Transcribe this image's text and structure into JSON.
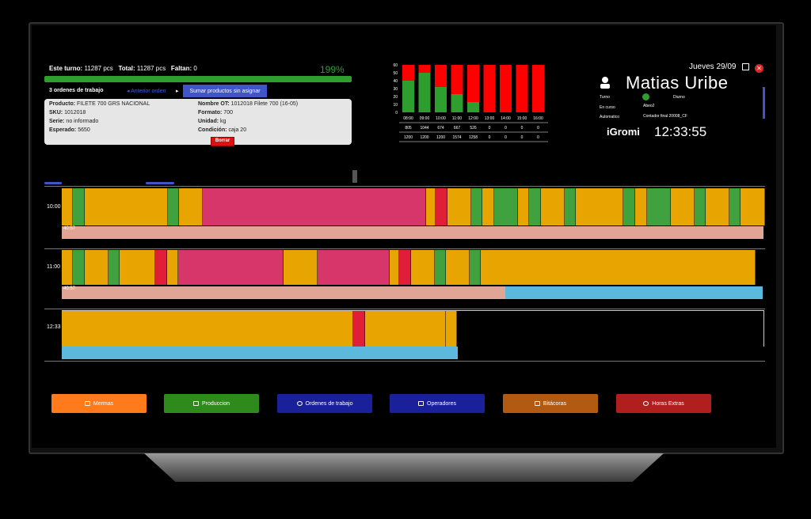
{
  "header": {
    "turno_label": "Este turno:",
    "turno_value": "11287 pcs",
    "total_label": "Total:",
    "total_value": "11287 pcs",
    "faltan_label": "Faltan:",
    "faltan_value": "0",
    "percent": "199%",
    "ordenes": "3 ordenes de trabajo",
    "nav_prev": "◂ Anterior orden",
    "nav_next": "▸",
    "asignar_button": "Sumar productos sin asignar"
  },
  "order": {
    "producto_label": "Producto:",
    "producto": "FILETE 700 GRS NACIONAL",
    "sku_label": "SKU:",
    "sku": "1012018",
    "serie_label": "Serie:",
    "serie": "no informado",
    "esperado_label": "Esperado:",
    "esperado": "5650",
    "nombre_label": "Nombre OT:",
    "nombre": "1012018 Filete 700 (16-05)",
    "formato_label": "Formato:",
    "formato": "700",
    "unidad_label": "Unidad:",
    "unidad": "kg",
    "condicion_label": "Condición:",
    "condicion": "caja 20",
    "borrar_button": "Borrar"
  },
  "chart_data": {
    "type": "bar",
    "categories": [
      "08:00",
      "09:00",
      "10:00",
      "11:00",
      "12:00",
      "13:00",
      "14:00",
      "15:00",
      "16:00"
    ],
    "series": [
      {
        "values": [
          40,
          50,
          32,
          23,
          13,
          0,
          0,
          0,
          0
        ],
        "color": "#2e9e2e"
      },
      {
        "values": [
          20,
          10,
          28,
          37,
          47,
          60,
          60,
          60,
          60
        ],
        "color": "#ff0000"
      }
    ],
    "ylim": [
      0,
      60
    ],
    "yticks": [
      0,
      10,
      20,
      30,
      40,
      50,
      60
    ],
    "row1": [
      "805",
      "1044",
      "674",
      "667",
      "526",
      "0",
      "0",
      "0",
      "0"
    ],
    "row2": [
      "1200",
      "1200",
      "1200",
      "1574",
      "1258",
      "0",
      "0",
      "0",
      "0"
    ]
  },
  "profile": {
    "date": "Jueves 29/09",
    "name": "Matias Uribe",
    "turno_label": "Turno",
    "turno_value": "Diurno",
    "encurso_label": "En curso",
    "encurso_value": "Abeo2",
    "automatico_label": "Automatico",
    "automatico_value": "Contador final 20008_CF",
    "logo": "iGromi",
    "clock": "12:33:55"
  },
  "gantt": {
    "row1_time": "10:00",
    "row1_dur": "40:57",
    "row2_time": "11:00",
    "row2_dur": "40:57",
    "row3_time": "12:33"
  },
  "colors": {
    "orange": "#e8a400",
    "green": "#3fa23f",
    "red": "#e01e37",
    "pink": "#d6366a",
    "salmon": "#e0a595",
    "cyan": "#5cb8dd"
  },
  "footer": {
    "mermas": "Mermas",
    "produccion": "Produccion",
    "ordenes": "Ordenes de trabajo",
    "operadores": "Operadores",
    "bitacoras": "Bitácoras",
    "horas_extras": "Horas Extras"
  }
}
